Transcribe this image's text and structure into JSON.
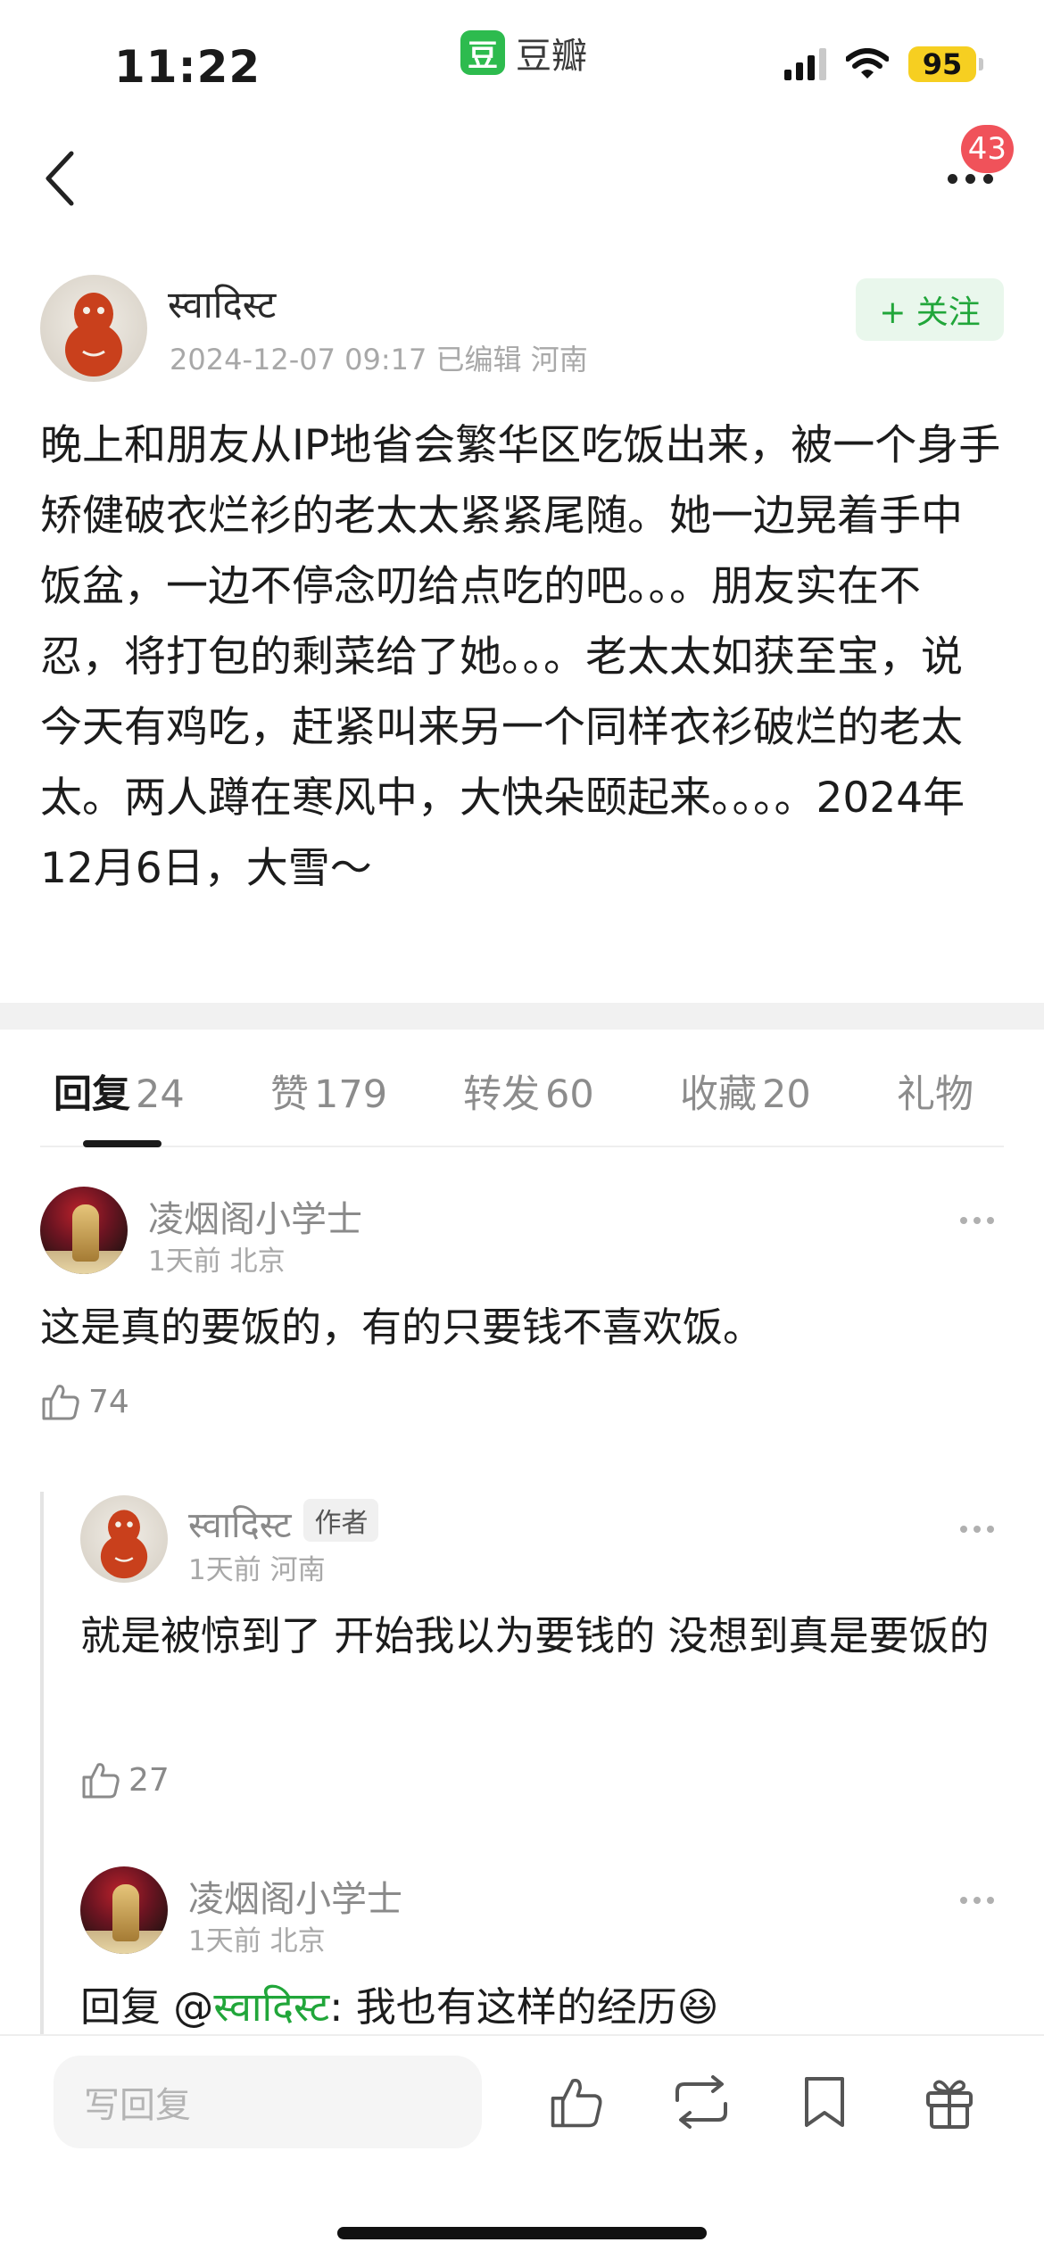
{
  "status_bar": {
    "time": "11:22",
    "app_logo_char": "豆",
    "app_name": "豆瓣",
    "battery": "95",
    "battery_color": "#f6cf21"
  },
  "nav": {
    "back_icon": "chevron-left-icon",
    "more_icon": "more-dots-icon",
    "notification_count": "43"
  },
  "post": {
    "author": "स्वादिस्ट",
    "meta": "2024-12-07 09:17 已编辑 河南",
    "follow_label": "+ 关注",
    "body": "晚上和朋友从IP地省会繁华区吃饭出来，被一个身手矫健破衣烂衫的老太太紧紧尾随。她一边晃着手中饭盆，一边不停念叨给点吃的吧。。。朋友实在不忍，将打包的剩菜给了她。。。老太太如获至宝，说今天有鸡吃，赶紧叫来另一个同样衣衫破烂的老太太。两人蹲在寒风中，大快朵颐起来。。。。2024年12月6日，大雪～"
  },
  "tabs": [
    {
      "label": "回复",
      "count": "24",
      "active": true
    },
    {
      "label": "赞",
      "count": "179",
      "active": false
    },
    {
      "label": "转发",
      "count": "60",
      "active": false
    },
    {
      "label": "收藏",
      "count": "20",
      "active": false
    },
    {
      "label": "礼物",
      "count": "",
      "active": false
    }
  ],
  "comments": [
    {
      "name": "凌烟阁小学士",
      "meta": "1天前 北京",
      "text": "这是真的要饭的，有的只要钱不喜欢饭。",
      "likes": "74"
    },
    {
      "name": "स्वादिस्ट",
      "tag": "作者",
      "meta": "1天前 河南",
      "text": "就是被惊到了 开始我以为要钱的 没想到真是要饭的",
      "likes": "27"
    },
    {
      "name": "凌烟阁小学士",
      "meta": "1天前 北京",
      "reply_prefix": "回复 @",
      "reply_to": "स्वादिस्ट",
      "text": ": 我也有这样的经历",
      "emoji": "😆"
    }
  ],
  "bottom_bar": {
    "placeholder": "写回复",
    "icons": [
      "thumbs-up-icon",
      "repost-icon",
      "bookmark-icon",
      "gift-icon"
    ]
  },
  "colors": {
    "accent_green": "#21a63a",
    "badge_red": "#f0525a"
  }
}
